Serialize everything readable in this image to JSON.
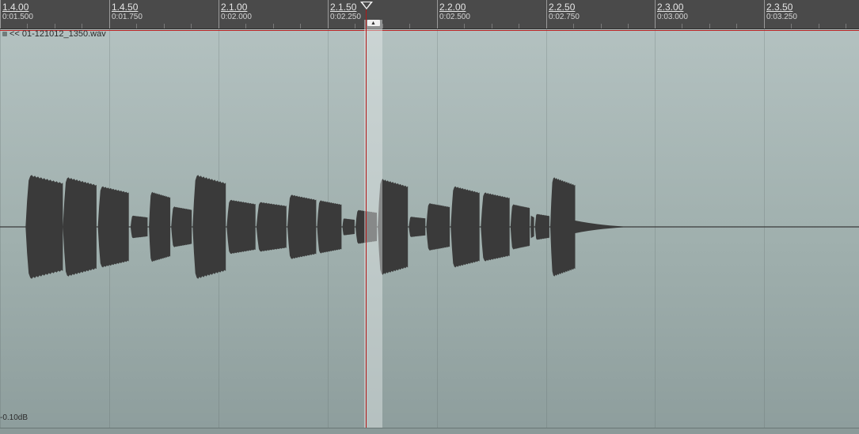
{
  "ruler": {
    "ticks": [
      {
        "measure": "1.4.00",
        "time": "0:01.500"
      },
      {
        "measure": "1.4.50",
        "time": "0:01.750"
      },
      {
        "measure": "2.1.00",
        "time": "0:02.000"
      },
      {
        "measure": "2.1.50",
        "time": "0:02.250"
      },
      {
        "measure": "2.2.00",
        "time": "0:02.500"
      },
      {
        "measure": "2.2.50",
        "time": "0:02.750"
      },
      {
        "measure": "2.3.00",
        "time": "0:03.000"
      },
      {
        "measure": "2.3.50",
        "time": "0:03.250"
      }
    ]
  },
  "item": {
    "name": "<< 01-121012_1350.wav",
    "gain": "-0.10dB"
  },
  "colors": {
    "waveform": "#3a3a3a",
    "playhead": "#b01818",
    "ruler_bg": "#4a4a4a"
  },
  "icons": {
    "lock": "lock-icon",
    "playhead_marker": "playhead-triangle-icon"
  },
  "waveform": {
    "bursts": [
      {
        "t0": 1.5585,
        "t1": 1.644,
        "amp": 0.92
      },
      {
        "t0": 1.644,
        "t1": 1.721,
        "amp": 0.88
      },
      {
        "t0": 1.724,
        "t1": 1.795,
        "amp": 0.72
      },
      {
        "t0": 1.799,
        "t1": 1.838,
        "amp": 0.2
      },
      {
        "t0": 1.841,
        "t1": 1.89,
        "amp": 0.62
      },
      {
        "t0": 1.892,
        "t1": 1.939,
        "amp": 0.36
      },
      {
        "t0": 1.941,
        "t1": 2.017,
        "amp": 0.92
      },
      {
        "t0": 2.019,
        "t1": 2.085,
        "amp": 0.48
      },
      {
        "t0": 2.087,
        "t1": 2.156,
        "amp": 0.44
      },
      {
        "t0": 2.158,
        "t1": 2.224,
        "amp": 0.57
      },
      {
        "t0": 2.226,
        "t1": 2.282,
        "amp": 0.47
      },
      {
        "t0": 2.284,
        "t1": 2.312,
        "amp": 0.15
      },
      {
        "t0": 2.314,
        "t1": 2.363,
        "amp": 0.3
      },
      {
        "t0": 2.365,
        "t1": 2.434,
        "amp": 0.85
      },
      {
        "t0": 2.436,
        "t1": 2.474,
        "amp": 0.18
      },
      {
        "t0": 2.476,
        "t1": 2.53,
        "amp": 0.42
      },
      {
        "t0": 2.532,
        "t1": 2.598,
        "amp": 0.72
      },
      {
        "t0": 2.601,
        "t1": 2.667,
        "amp": 0.61
      },
      {
        "t0": 2.669,
        "t1": 2.713,
        "amp": 0.4
      },
      {
        "t0": 2.715,
        "t1": 2.723,
        "amp": 0.2
      },
      {
        "t0": 2.725,
        "t1": 2.758,
        "amp": 0.23
      },
      {
        "t0": 2.76,
        "t1": 2.817,
        "amp": 0.88
      }
    ]
  }
}
